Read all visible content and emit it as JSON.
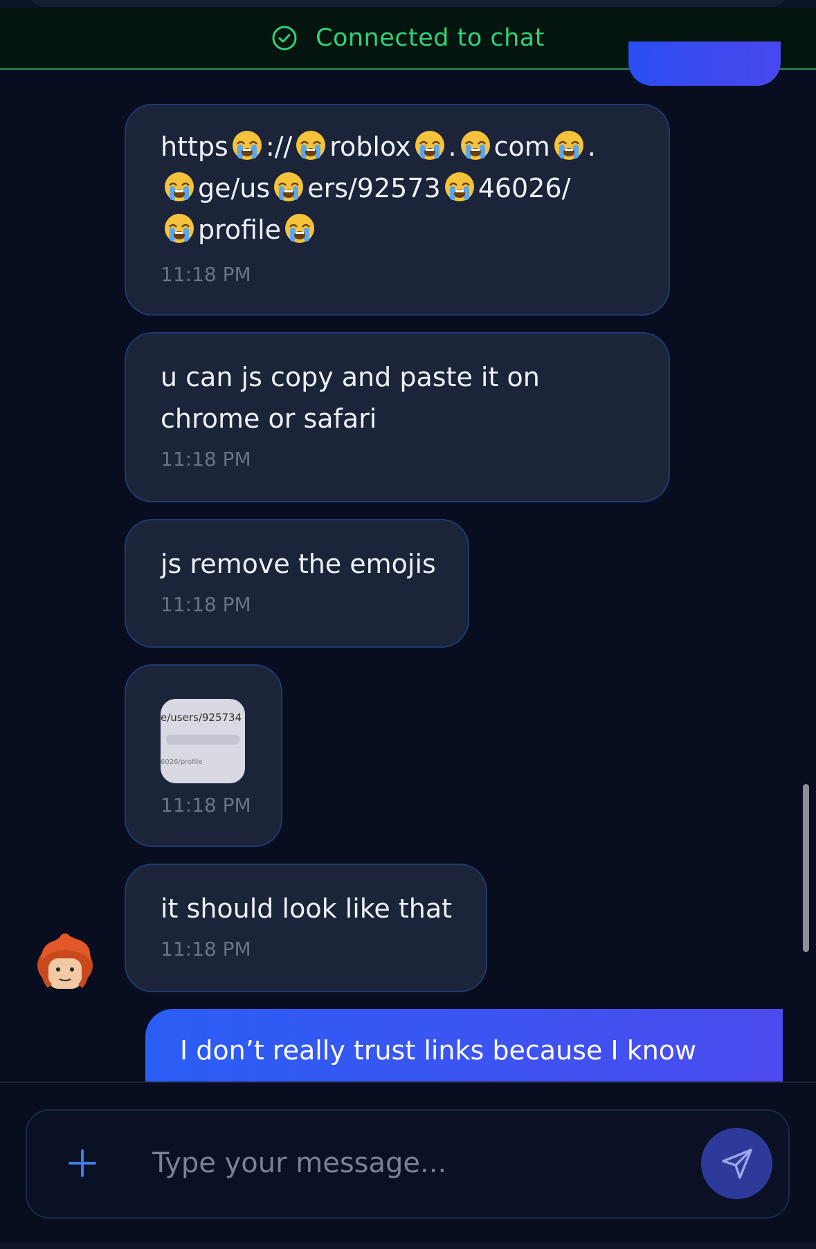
{
  "status_banner": {
    "label": "Connected to chat",
    "icon": "check-circle-icon",
    "color": "#2fd27a"
  },
  "messages": [
    {
      "type": "text",
      "lines": [
        "https",
        "://",
        "roblox",
        ".",
        "com",
        ".",
        "ge/us",
        "ers/92573",
        "46026/",
        "profile"
      ],
      "emoji": "loudly-crying-face",
      "time": "11:18 PM"
    },
    {
      "type": "text",
      "lines": [
        "u can js copy and paste it on",
        "chrome or safari"
      ],
      "time": "11:18 PM"
    },
    {
      "type": "text",
      "lines": [
        "js remove the emojis"
      ],
      "time": "11:18 PM"
    },
    {
      "type": "image",
      "thumb_top": "e/users/925734",
      "thumb_bottom": "6026/profile",
      "time": "11:18 PM"
    },
    {
      "type": "text",
      "lines": [
        "it should look like that"
      ],
      "time": "11:18 PM"
    }
  ],
  "sent_preview": {
    "text": "I don’t really trust links because I know"
  },
  "composer": {
    "placeholder": "Type your message...",
    "add_icon": "plus-icon",
    "send_icon": "send-icon"
  },
  "colors": {
    "accent": "#2a5ef5",
    "bubble": "#1b2439",
    "background": "#080d1f"
  }
}
